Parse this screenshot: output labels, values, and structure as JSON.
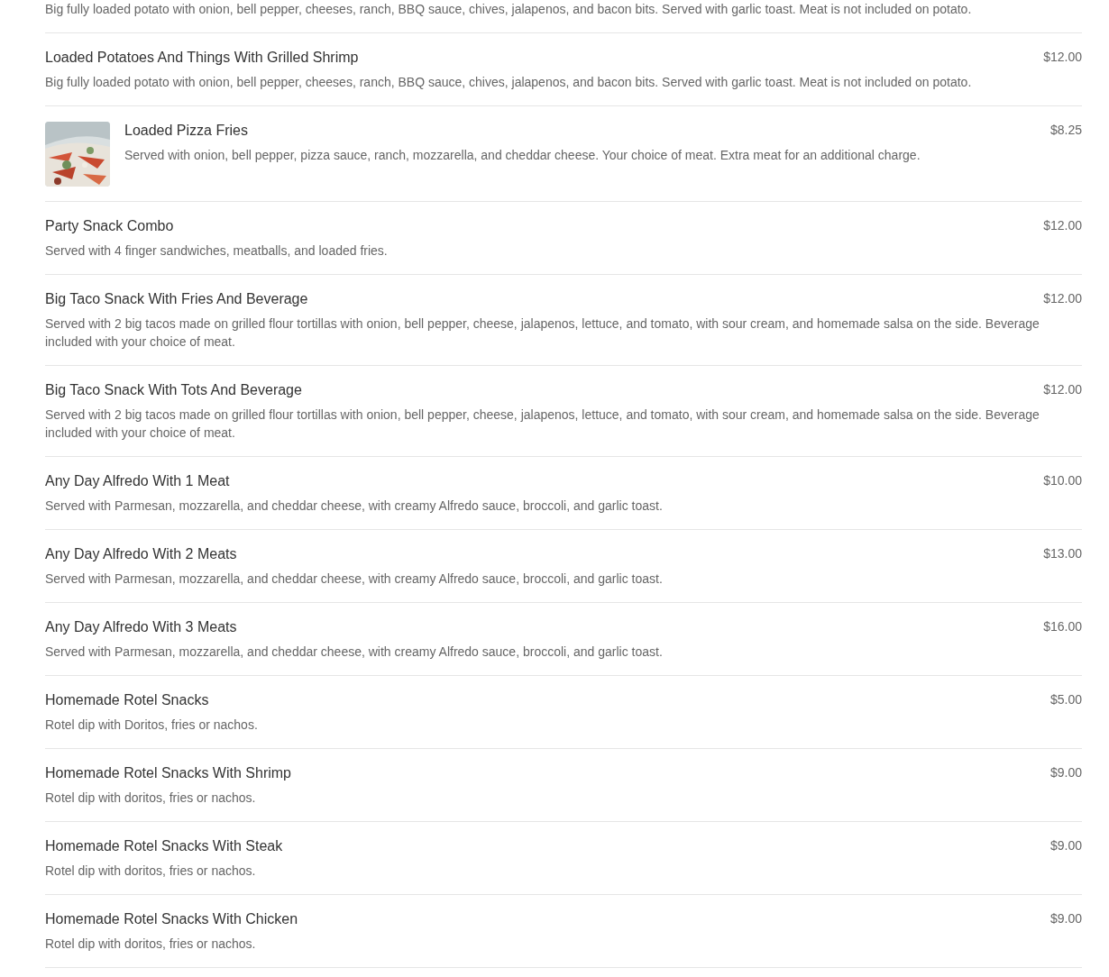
{
  "menu_items": [
    {
      "description": "Big fully loaded potato with onion, bell pepper, cheeses, ranch, BBQ sauce, chives, jalapenos, and bacon bits. Served with garlic toast. Meat is not included on potato."
    },
    {
      "title": "Loaded Potatoes And Things With Grilled Shrimp",
      "price": "$12.00",
      "description": "Big fully loaded potato with onion, bell pepper, cheeses, ranch, BBQ sauce, chives, jalapenos, and bacon bits. Served with garlic toast. Meat is not included on potato."
    },
    {
      "title": "Loaded Pizza Fries",
      "price": "$8.25",
      "description": "Served with onion, bell pepper, pizza sauce, ranch, mozzarella, and cheddar cheese. Your choice of meat. Extra meat for an additional charge."
    },
    {
      "title": "Party Snack Combo",
      "price": "$12.00",
      "description": "Served with 4 finger sandwiches, meatballs, and loaded fries."
    },
    {
      "title": "Big Taco Snack With Fries And Beverage",
      "price": "$12.00",
      "description": "Served with 2 big tacos made on grilled flour tortillas with onion, bell pepper, cheese, jalapenos, lettuce, and tomato, with sour cream, and homemade salsa on the side. Beverage included with your choice of meat."
    },
    {
      "title": "Big Taco Snack With Tots And Beverage",
      "price": "$12.00",
      "description": "Served with 2 big tacos made on grilled flour tortillas with onion, bell pepper, cheese, jalapenos, lettuce, and tomato, with sour cream, and homemade salsa on the side. Beverage included with your choice of meat."
    },
    {
      "title": "Any Day Alfredo With 1 Meat",
      "price": "$10.00",
      "description": "Served with Parmesan, mozzarella, and cheddar cheese, with creamy Alfredo sauce, broccoli, and garlic toast."
    },
    {
      "title": "Any Day Alfredo With 2 Meats",
      "price": "$13.00",
      "description": "Served with Parmesan, mozzarella, and cheddar cheese, with creamy Alfredo sauce, broccoli, and garlic toast."
    },
    {
      "title": "Any Day Alfredo With 3 Meats",
      "price": "$16.00",
      "description": "Served with Parmesan, mozzarella, and cheddar cheese, with creamy Alfredo sauce, broccoli, and garlic toast."
    },
    {
      "title": "Homemade Rotel Snacks",
      "price": "$5.00",
      "description": "Rotel dip with Doritos, fries or nachos."
    },
    {
      "title": "Homemade Rotel Snacks With Shrimp",
      "price": "$9.00",
      "description": "Rotel dip with doritos, fries or nachos."
    },
    {
      "title": "Homemade Rotel Snacks With Steak",
      "price": "$9.00",
      "description": "Rotel dip with doritos, fries or nachos."
    },
    {
      "title": "Homemade Rotel Snacks With Chicken",
      "price": "$9.00",
      "description": "Rotel dip with doritos, fries or nachos."
    }
  ]
}
